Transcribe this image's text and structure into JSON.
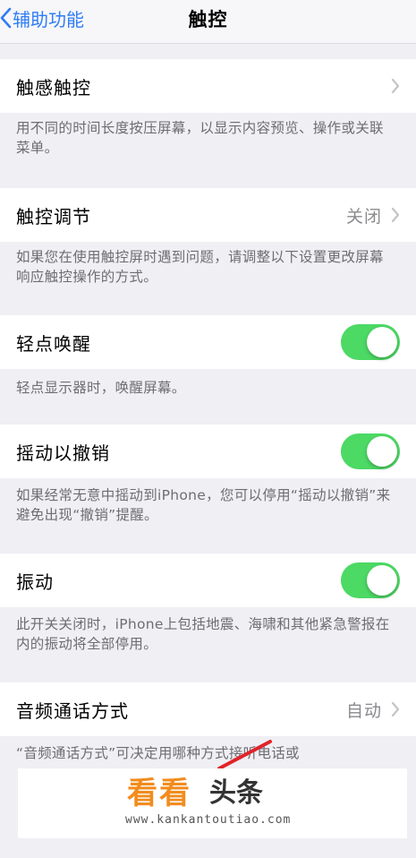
{
  "navbar": {
    "back_label": "辅助功能",
    "title": "触控"
  },
  "rows": [
    {
      "label": "触感触控",
      "value": "",
      "desc": "用不同的时间长度按压屏幕，以显示内容预览、操作或关联菜单。"
    },
    {
      "label": "触控调节",
      "value": "关闭",
      "desc": "如果您在使用触控屏时遇到问题，请调整以下设置更改屏幕响应触控操作的方式。"
    },
    {
      "label": "轻点唤醒",
      "toggle": true,
      "desc": "轻点显示器时，唤醒屏幕。"
    },
    {
      "label": "摇动以撤销",
      "toggle": true,
      "desc": "如果经常无意中摇动到iPhone，您可以停用“摇动以撤销”来避免出现“撤销”提醒。"
    },
    {
      "label": "振动",
      "toggle": true,
      "desc": "此开关关闭时，iPhone上包括地震、海啸和其他紧急警报在内的振动将全部停用。"
    },
    {
      "label": "音频通话方式",
      "value": "自动",
      "desc": "“音频通话方式”可决定用哪种方式接听电话或"
    }
  ],
  "watermark": {
    "brand": "看看",
    "brand_suffix": "头条",
    "url": "www.kankantoutiao.com"
  },
  "colors": {
    "accent": "#2f7cf6",
    "toggle_on": "#4cd964",
    "brand": "#f28c1e"
  }
}
